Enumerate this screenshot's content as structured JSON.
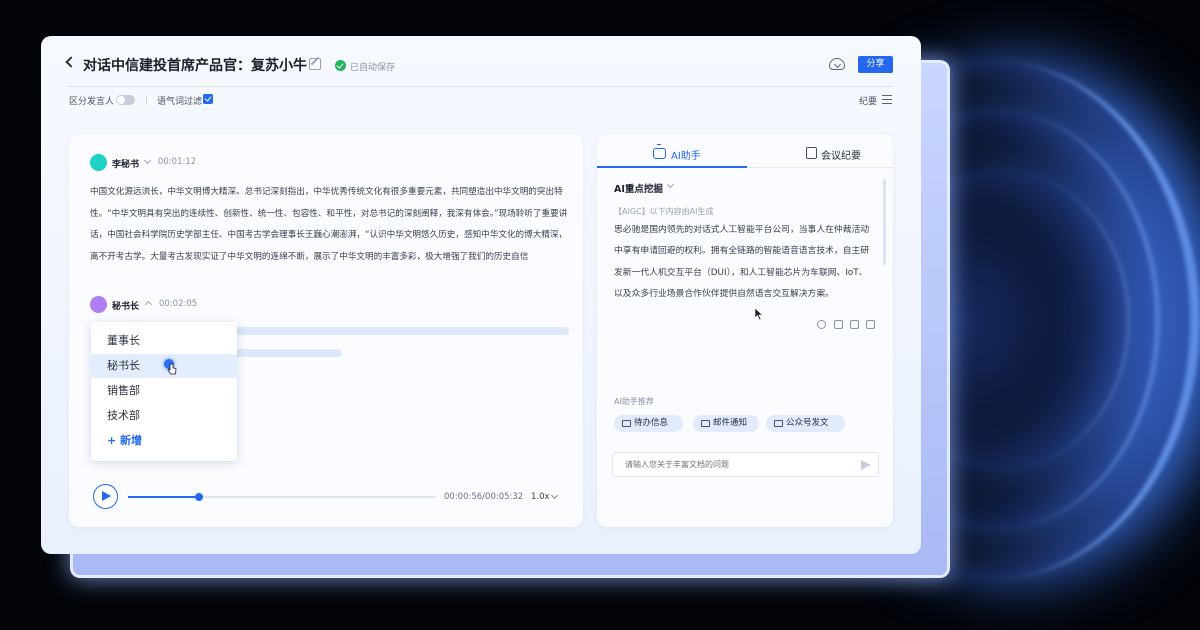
{
  "header": {
    "title": "对话中信建投首席产品官：复苏小牛",
    "saved_text": "已自动保存",
    "share_label": "分享"
  },
  "toolbar": {
    "speaker_toggle_label": "区分发言人",
    "speaker_toggle_on": false,
    "filter_label": "语气词过滤",
    "filter_checked": true,
    "minutes_label": "纪要"
  },
  "transcript": {
    "speaker1": {
      "name": "李秘书",
      "time": "00:01:12",
      "text": "中国文化源远流长，中华文明博大精深。总书记深刻指出，中华优秀传统文化有很多重要元素，共同塑造出中华文明的突出特性。“中华文明具有突出的连续性、创新性、统一性、包容性、和平性，对总书记的深刻阐释，我深有体会。”现场聆听了重要讲话，中国社会科学院历史学部主任、中国考古学会理事长王巍心潮澎湃，“认识中华文明悠久历史，感知中华文化的博大精深，离不开考古学。大量考古发现实证了中华文明的连绵不断，展示了中华文明的丰富多彩，极大增强了我们的历史自信"
    },
    "speaker2": {
      "name": "秘书长",
      "time": "00:02:05"
    },
    "dropdown": {
      "items": [
        "董事长",
        "秘书长",
        "销售部",
        "技术部"
      ],
      "active_index": 1,
      "add_label": "+ 新增"
    }
  },
  "player": {
    "time_readout": "00:00:56/00:05:32",
    "progress": 0.23,
    "speed": "1.0x"
  },
  "assistant": {
    "tab_ai": "AI助手",
    "tab_minutes": "会议纪要",
    "active_tab": "AI助手",
    "section_title": "AI重点挖掘",
    "aigc_note": "【AIGC】以下内容由AI生成",
    "content": "思必驰是国内领先的对话式人工智能平台公司，当事人在仲裁活动中享有申请回避的权利。拥有全链路的智能语音语言技术，自主研发新一代人机交互平台（DUI），和人工智能芯片为车联网、IoT、以及众多行业场景合作伙伴提供自然语言交互解决方案。",
    "recommend_label": "AI助手推荐",
    "chips": [
      "待办信息",
      "邮件通知",
      "公众号发文"
    ],
    "input_placeholder": "请输入您关于丰富文档的问题"
  },
  "colors": {
    "accent": "#2468f2",
    "speaker1_avatar": "#1fd0c4",
    "speaker2_avatar": "#b07ef0",
    "saved_green": "#22b35e"
  }
}
